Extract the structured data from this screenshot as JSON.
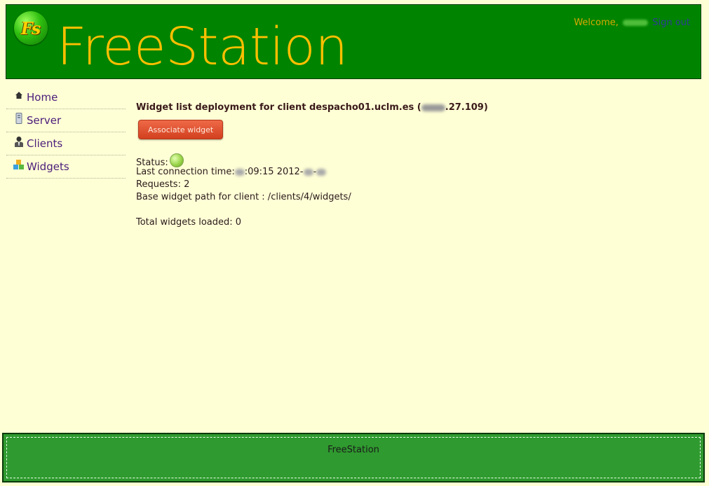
{
  "header": {
    "logo_text": "Fs",
    "site_title": "FreeStation",
    "welcome_text": "Welcome,",
    "signout_label": "Sign out"
  },
  "sidebar": {
    "items": [
      {
        "label": "Home",
        "icon": "home-icon"
      },
      {
        "label": "Server",
        "icon": "server-icon"
      },
      {
        "label": "Clients",
        "icon": "user-icon"
      },
      {
        "label": "Widgets",
        "icon": "widgets-icon"
      }
    ]
  },
  "main": {
    "title_prefix": "Widget list deployment for client despacho01.uclm.es (",
    "title_ip_suffix": ".27.109)",
    "associate_button": "Associate widget",
    "status_label": "Status:",
    "status_color": "#9ad44a",
    "last_connection_label": "Last connection time:",
    "last_connection_time_part": ":09:15 2012-",
    "requests": "Requests: 2",
    "base_path": "Base widget path for client : /clients/4/widgets/",
    "total_widgets": "Total widgets loaded: 0"
  },
  "footer": {
    "text": "FreeStation"
  },
  "colors": {
    "header_bg": "#008400",
    "title": "#ffbf00",
    "page_bg": "#ffffd6",
    "button": "#e0502e",
    "footer_bg": "#2f9a2f"
  }
}
